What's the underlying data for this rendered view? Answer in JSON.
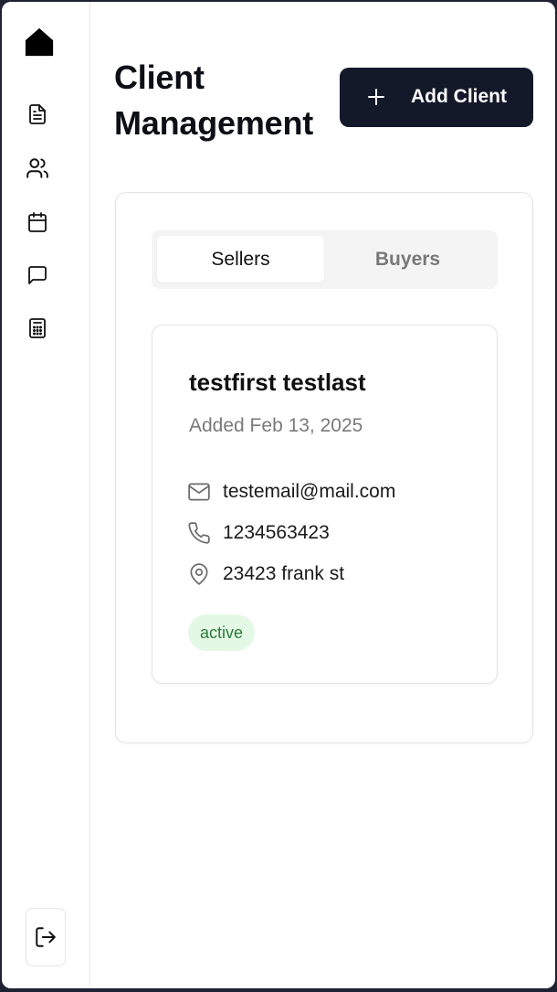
{
  "sidebar": {
    "logo_icon": "home-icon",
    "items": [
      {
        "id": "documents",
        "icon": "file-text-icon"
      },
      {
        "id": "clients",
        "icon": "users-icon"
      },
      {
        "id": "calendar",
        "icon": "calendar-icon"
      },
      {
        "id": "messages",
        "icon": "message-square-icon"
      },
      {
        "id": "calculator",
        "icon": "calculator-icon"
      }
    ],
    "logout_icon": "log-out-icon"
  },
  "header": {
    "title": "Client Management",
    "add_button_label": "Add Client"
  },
  "tabs": [
    {
      "label": "Sellers",
      "active": true
    },
    {
      "label": "Buyers",
      "active": false
    }
  ],
  "clients": [
    {
      "name": "testfirst testlast",
      "added": "Added Feb 13, 2025",
      "email": "testemail@mail.com",
      "phone": "1234563423",
      "address": "23423 frank st",
      "status": "active"
    }
  ],
  "colors": {
    "primary_button": "#131929",
    "status_active_bg": "#e4f8e6",
    "status_active_text": "#2d7a3a"
  }
}
